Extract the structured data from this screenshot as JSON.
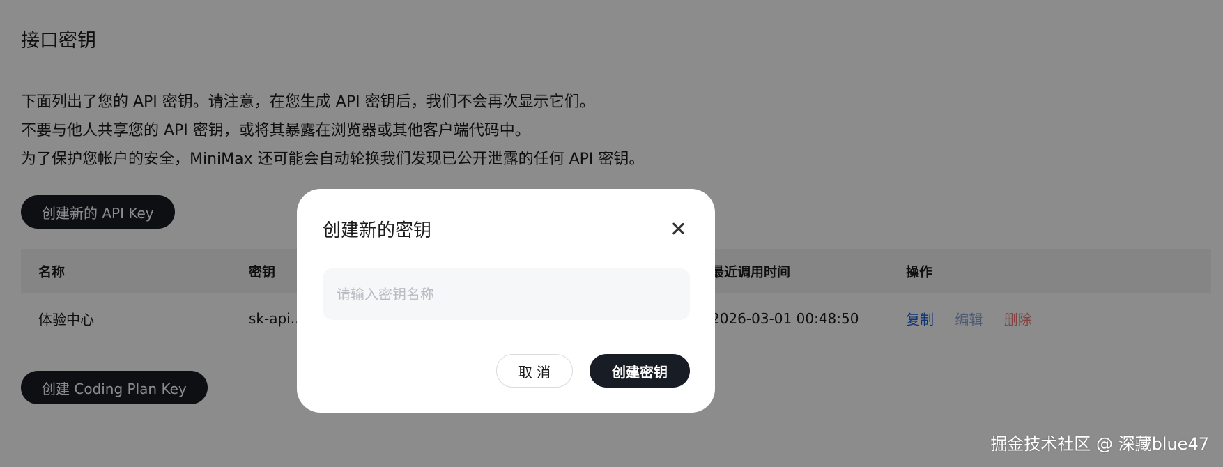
{
  "page": {
    "title": "接口密钥",
    "description": [
      "下面列出了您的 API 密钥。请注意，在您生成 API 密钥后，我们不会再次显示它们。",
      "不要与他人共享您的 API 密钥，或将其暴露在浏览器或其他客户端代码中。",
      "为了保护您帐户的安全，MiniMax 还可能会自动轮换我们发现已公开泄露的任何 API 密钥。"
    ],
    "create_api_key_label": "创建新的 API Key",
    "create_coding_plan_key_label": "创建 Coding Plan Key"
  },
  "table": {
    "headers": {
      "name": "名称",
      "key": "密钥",
      "last_used": "最近调用时间",
      "actions": "操作"
    },
    "rows": [
      {
        "name": "体验中心",
        "key": "sk-api...",
        "last_used": "2026-03-01 00:48:50",
        "copy": "复制",
        "edit": "编辑",
        "delete": "删除"
      }
    ]
  },
  "modal": {
    "title": "创建新的密钥",
    "input_placeholder": "请输入密钥名称",
    "input_value": "",
    "cancel_label": "取 消",
    "confirm_label": "创建密钥"
  },
  "watermark": "掘金技术社区 @ 深藏blue47",
  "colors": {
    "primary_dark": "#181c24",
    "link_blue": "#1f5fd6",
    "danger": "#ef7a7a",
    "overlay": "rgba(0,0,0,0.45)"
  }
}
